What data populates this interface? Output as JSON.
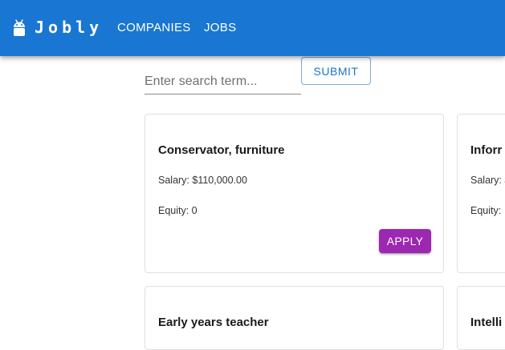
{
  "header": {
    "brand": "Jobly",
    "nav": [
      {
        "label": "COMPANIES"
      },
      {
        "label": "JOBS"
      }
    ],
    "icon": "android-icon"
  },
  "search": {
    "placeholder": "Enter search term...",
    "value": "",
    "submit_label": "SUBMIT"
  },
  "colors": {
    "appbar": "#1976d2",
    "apply": "#9c27b0"
  },
  "jobs": [
    {
      "title": "Conservator, furniture",
      "salary": "Salary: $110,000.00",
      "equity": "Equity: 0",
      "apply_label": "APPLY"
    },
    {
      "title": "Inforr",
      "salary": "Salary: $",
      "equity": "Equity:"
    },
    {
      "title": "Early years teacher"
    },
    {
      "title": "Intelli"
    }
  ]
}
